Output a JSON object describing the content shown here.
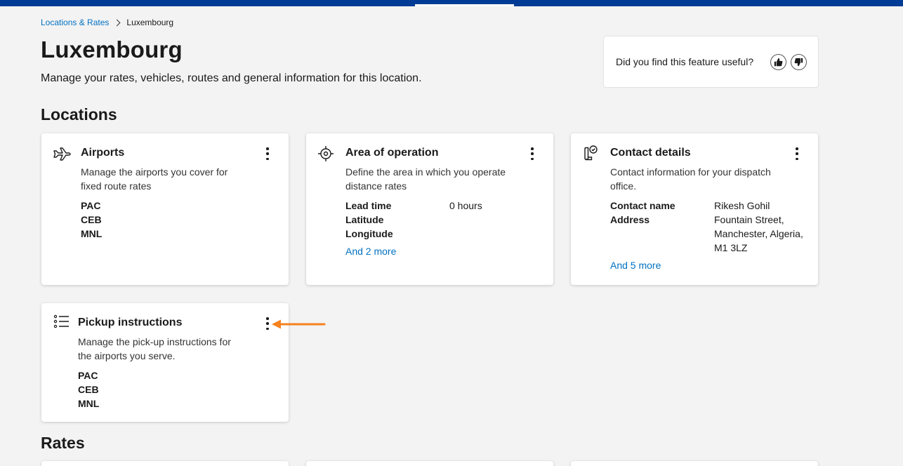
{
  "breadcrumb": {
    "parent": "Locations & Rates",
    "current": "Luxembourg"
  },
  "page": {
    "title": "Luxembourg",
    "description": "Manage your rates, vehicles, routes and general information for this location."
  },
  "feedback": {
    "question": "Did you find this feature useful?"
  },
  "sections": {
    "locations": "Locations",
    "rates": "Rates"
  },
  "cards": {
    "airports": {
      "title": "Airports",
      "description": "Manage the airports you cover for fixed route rates",
      "codes": [
        "PAC",
        "CEB",
        "MNL"
      ]
    },
    "area": {
      "title": "Area of operation",
      "description": "Define the area in which you operate distance rates",
      "rows": [
        {
          "k": "Lead time",
          "v": "0 hours"
        },
        {
          "k": "Latitude",
          "v": ""
        },
        {
          "k": "Longitude",
          "v": ""
        }
      ],
      "more": "And 2 more"
    },
    "contact": {
      "title": "Contact details",
      "description": "Contact information for your dispatch office.",
      "contact_name_label": "Contact name",
      "contact_name": "Rikesh Gohil",
      "address_label": "Address",
      "address": "Fountain Street, Manchester, Algeria, M1 3LZ",
      "more": "And 5 more"
    },
    "pickup": {
      "title": "Pickup instructions",
      "description": "Manage the pick-up instructions for the airports you serve.",
      "codes": [
        "PAC",
        "CEB",
        "MNL"
      ]
    }
  },
  "colors": {
    "brand": "#003b95",
    "link": "#0071c2",
    "annotation_arrow": "#f5821f"
  }
}
